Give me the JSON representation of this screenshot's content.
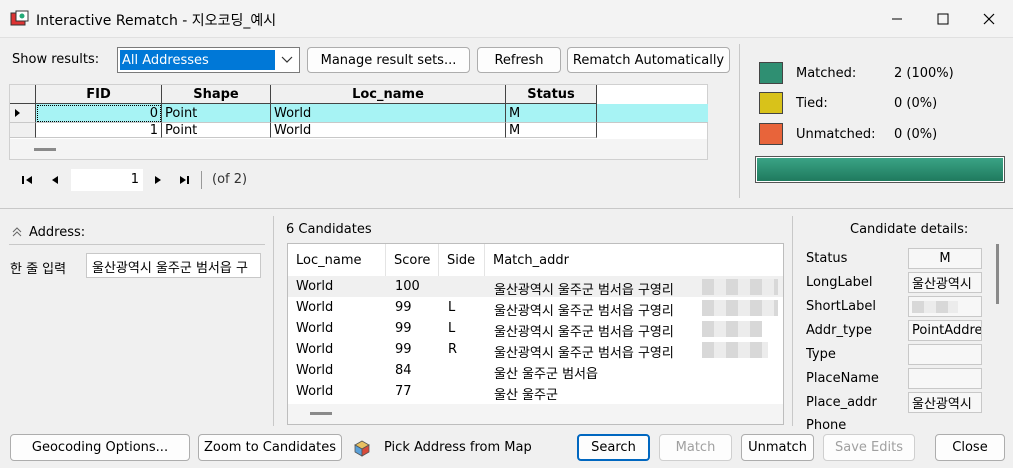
{
  "window": {
    "title": "Interactive Rematch - 지오코딩_예시"
  },
  "toolbar": {
    "show_results_label": "Show results:",
    "show_results_value": "All Addresses",
    "manage_label": "Manage result sets...",
    "refresh_label": "Refresh",
    "rematch_auto_label": "Rematch Automatically"
  },
  "results_table": {
    "columns": [
      "FID",
      "Shape",
      "Loc_name",
      "Status"
    ],
    "rows": [
      {
        "fid": "0",
        "shape": "Point",
        "loc_name": "World",
        "status": "M"
      },
      {
        "fid": "1",
        "shape": "Point",
        "loc_name": "World",
        "status": "M"
      }
    ]
  },
  "navigator": {
    "current": "1",
    "of_text": "(of 2)"
  },
  "stats": {
    "matched_label": "Matched:",
    "matched_value": "2 (100%)",
    "tied_label": "Tied:",
    "tied_value": "0 (0%)",
    "unmatched_label": "Unmatched:",
    "unmatched_value": "0 (0%)",
    "matched_fraction": 1.0,
    "colors": {
      "matched": "#2f8f72",
      "tied": "#d8c21a",
      "unmatched": "#e8643a"
    }
  },
  "address": {
    "title": "Address:",
    "field_label": "한 줄 입력",
    "field_value": "울산광역시 울주군 범서읍 구"
  },
  "candidates": {
    "title": "6 Candidates",
    "columns": [
      "Loc_name",
      "Score",
      "Side",
      "Match_addr"
    ],
    "rows": [
      {
        "loc": "World",
        "score": "100",
        "side": "",
        "addr": "울산광역시 울주군 범서읍 구영리"
      },
      {
        "loc": "World",
        "score": "99",
        "side": "L",
        "addr": "울산광역시 울주군 범서읍 구영리"
      },
      {
        "loc": "World",
        "score": "99",
        "side": "L",
        "addr": "울산광역시 울주군 범서읍 구영리"
      },
      {
        "loc": "World",
        "score": "99",
        "side": "R",
        "addr": "울산광역시 울주군 범서읍 구영리"
      },
      {
        "loc": "World",
        "score": "84",
        "side": "",
        "addr": "울산 울주군 범서읍"
      },
      {
        "loc": "World",
        "score": "77",
        "side": "",
        "addr": "울산 울주군"
      }
    ]
  },
  "details": {
    "title": "Candidate details:",
    "fields": [
      {
        "label": "Status",
        "value": "M"
      },
      {
        "label": "LongLabel",
        "value": "울산광역시"
      },
      {
        "label": "ShortLabel",
        "value": ""
      },
      {
        "label": "Addr_type",
        "value": "PointAddre"
      },
      {
        "label": "Type",
        "value": ""
      },
      {
        "label": "PlaceName",
        "value": ""
      },
      {
        "label": "Place_addr",
        "value": "울산광역시"
      },
      {
        "label": "Phone",
        "value": ""
      }
    ]
  },
  "footer": {
    "geocoding_options": "Geocoding Options...",
    "zoom_to_candidates": "Zoom to Candidates",
    "pick_address": "Pick Address from Map",
    "search": "Search",
    "match": "Match",
    "unmatch": "Unmatch",
    "save_edits": "Save Edits",
    "close": "Close"
  }
}
